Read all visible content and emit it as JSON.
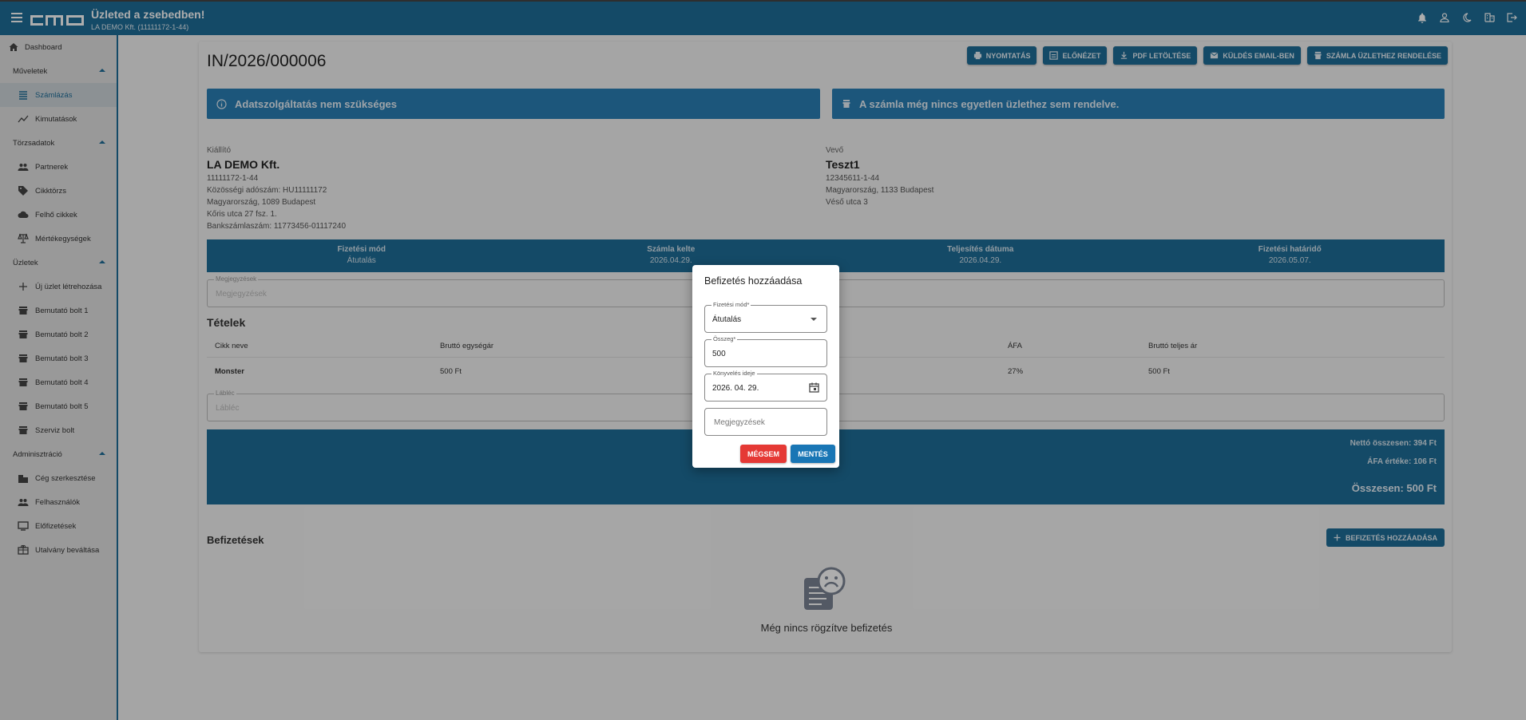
{
  "header": {
    "title": "Üzleted a zsebedben!",
    "company": "LA DEMO Kft. (11111172-1-44)"
  },
  "sidebar": {
    "dashboard": "Dashboard",
    "sections": [
      {
        "label": "Műveletek",
        "items": [
          "Számlázás",
          "Kimutatások"
        ]
      },
      {
        "label": "Törzsadatok",
        "items": [
          "Partnerek",
          "Cikktörzs",
          "Felhő cikkek",
          "Mértékegységek"
        ]
      },
      {
        "label": "Üzletek",
        "items": [
          "Új üzlet létrehozása",
          "Bemutató bolt 1",
          "Bemutató bolt 2",
          "Bemutató bolt 3",
          "Bemutató bolt 4",
          "Bemutató bolt 5",
          "Szerviz bolt"
        ]
      },
      {
        "label": "Adminisztráció",
        "items": [
          "Cég szerkesztése",
          "Felhasználók",
          "Előfizetések",
          "Utalvány beváltása"
        ]
      }
    ],
    "active": "Számlázás"
  },
  "invoice": {
    "number": "IN/2026/000006",
    "actions": [
      "NYOMTATÁS",
      "ELŐNÉZET",
      "PDF LETÖLTÉSE",
      "KÜLDÉS EMAIL-BEN",
      "SZÁMLA ÜZLETHEZ RENDELÉSE"
    ],
    "banner_left": "Adatszolgáltatás nem szükséges",
    "banner_right": "A számla még nincs egyetlen üzlethez sem rendelve.",
    "issuer": {
      "label": "Kiállító",
      "name": "LA DEMO Kft.",
      "lines": [
        "11111172-1-44",
        "Közösségi adószám: HU11111172",
        "Magyarország, 1089 Budapest",
        "Kőris utca 27 fsz. 1.",
        "Bankszámlaszám: 11773456-01117240"
      ]
    },
    "buyer": {
      "label": "Vevő",
      "name": "Teszt1",
      "lines": [
        "12345611-1-44",
        "Magyarország, 1133 Budapest",
        "Véső utca 3"
      ]
    },
    "info": [
      {
        "label": "Fizetési mód",
        "value": "Átutalás"
      },
      {
        "label": "Számla kelte",
        "value": "2026.04.29."
      },
      {
        "label": "Teljesítés dátuma",
        "value": "2026.04.29."
      },
      {
        "label": "Fizetési határidő",
        "value": "2026.05.07."
      }
    ],
    "notes_label": "Megjegyzések",
    "notes_placeholder": "Megjegyzések",
    "items_title": "Tételek",
    "columns": [
      "Cikk neve",
      "Bruttó egységár",
      "ÁFA",
      "Bruttó teljes ár"
    ],
    "rows": [
      {
        "name": "Monster",
        "unit_price": "500 Ft",
        "vat": "27%",
        "total": "500 Ft"
      }
    ],
    "footer_label": "Lábléc",
    "footer_placeholder": "Lábléc",
    "net_total": "Nettó összesen: 394 Ft",
    "vat_total": "ÁFA értéke: 106 Ft",
    "grand_total": "Összesen: 500 Ft",
    "payments_title": "Befizetések",
    "add_payment_btn": "BEFIZETÉS HOZZÁADÁSA",
    "no_payments": "Még nincs rögzítve befizetés"
  },
  "dialog": {
    "title": "Befizetés hozzáadása",
    "payment_method_label": "Fizetési mód*",
    "payment_method_value": "Átutalás",
    "amount_label": "Összeg*",
    "amount_value": "500",
    "booking_label": "Könyvelés ideje",
    "booking_value": "2026. 04. 29.",
    "notes_placeholder": "Megjegyzések",
    "cancel": "MÉGSEM",
    "save": "MENTÉS"
  },
  "colors": {
    "primary": "#1e6d98",
    "banner": "#2a7fb5",
    "cancel": "#e53935",
    "save": "#1976b5"
  }
}
